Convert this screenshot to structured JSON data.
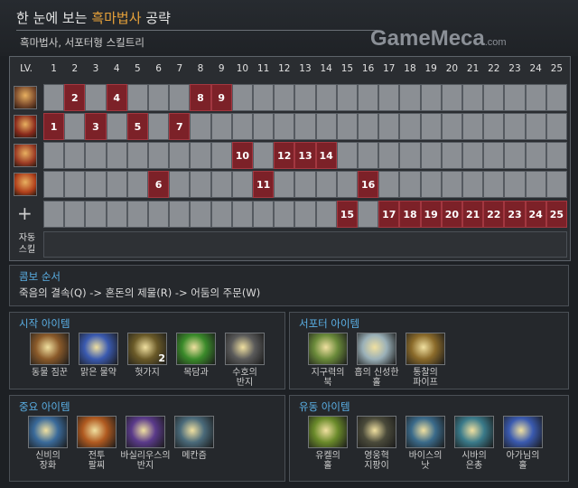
{
  "header": {
    "title_prefix": "한 눈에 보는 ",
    "title_highlight": "흑마법사",
    "title_suffix": " 공략",
    "subtitle": "흑마법사, 서포터형 스킬트리",
    "logo": "GameMeca",
    "logo_suffix": ".com"
  },
  "skill_table": {
    "level_label": "LV.",
    "levels": [
      "1",
      "2",
      "3",
      "4",
      "5",
      "6",
      "7",
      "8",
      "9",
      "10",
      "11",
      "12",
      "13",
      "14",
      "15",
      "16",
      "17",
      "18",
      "19",
      "20",
      "21",
      "22",
      "23",
      "24",
      "25"
    ],
    "rows": [
      {
        "icon": "skill-q-icon",
        "color": "#7a4a2c",
        "picks": [
          "",
          "2",
          "",
          "4",
          "",
          "",
          "",
          "8",
          "9",
          "",
          "",
          "",
          "",
          "",
          "",
          "",
          "",
          "",
          "",
          "",
          "",
          "",
          "",
          "",
          ""
        ]
      },
      {
        "icon": "skill-w-icon",
        "color": "#8a2a1c",
        "picks": [
          "1",
          "",
          "3",
          "",
          "5",
          "",
          "7",
          "",
          "",
          "",
          "",
          "",
          "",
          "",
          "",
          "",
          "",
          "",
          "",
          "",
          "",
          "",
          "",
          "",
          ""
        ]
      },
      {
        "icon": "skill-e-icon",
        "color": "#9a3a24",
        "picks": [
          "",
          "",
          "",
          "",
          "",
          "",
          "",
          "",
          "",
          "10",
          "",
          "12",
          "13",
          "14",
          "",
          "",
          "",
          "",
          "",
          "",
          "",
          "",
          "",
          "",
          ""
        ]
      },
      {
        "icon": "skill-r-icon",
        "color": "#b0401c",
        "picks": [
          "",
          "",
          "",
          "",
          "",
          "6",
          "",
          "",
          "",
          "",
          "11",
          "",
          "",
          "",
          "",
          "16",
          "",
          "",
          "",
          "",
          "",
          "",
          "",
          "",
          ""
        ]
      },
      {
        "icon": "plus-icon",
        "color": "",
        "picks": [
          "",
          "",
          "",
          "",
          "",
          "",
          "",
          "",
          "",
          "",
          "",
          "",
          "",
          "",
          "15",
          "",
          "17",
          "18",
          "19",
          "20",
          "21",
          "22",
          "23",
          "24",
          "25"
        ]
      }
    ],
    "plus_symbol": "+",
    "auto_skill_label_1": "자동",
    "auto_skill_label_2": "스킬"
  },
  "combo": {
    "title": "콤보 순서",
    "text": "죽음의 결속(Q) -> 혼돈의 제물(R) -> 어둠의 주문(W)"
  },
  "starting_items": {
    "title": "시작 아이템",
    "items": [
      {
        "icon": "courier-icon",
        "color": "#8a5a2a",
        "line1": "동물 짐꾼",
        "line2": "",
        "badge": ""
      },
      {
        "icon": "clarity-potion-icon",
        "color": "#3a5ab0",
        "line1": "맑은 물약",
        "line2": "",
        "badge": ""
      },
      {
        "icon": "branch-icon",
        "color": "#6a5a28",
        "line1": "헛가지",
        "line2": "",
        "badge": "2"
      },
      {
        "icon": "magic-stick-icon",
        "color": "#3a8a2a",
        "line1": "목담과",
        "line2": "",
        "badge": ""
      },
      {
        "icon": "ring-of-protection-icon",
        "color": "#5a5a5a",
        "line1": "수호의",
        "line2": "반지",
        "badge": ""
      }
    ]
  },
  "support_items": {
    "title": "서포터 아이템",
    "items": [
      {
        "icon": "tome-icon",
        "color": "#6a8a3a",
        "line1": "지구력의",
        "line2": "북",
        "badge": ""
      },
      {
        "icon": "wind-lace-icon",
        "color": "#9ab0b8",
        "line1": "흡의 신성한",
        "line2": "홀",
        "badge": ""
      },
      {
        "icon": "flute-icon",
        "color": "#8a6a2a",
        "line1": "통찰의",
        "line2": "파이프",
        "badge": ""
      }
    ]
  },
  "core_items": {
    "title": "중요 아이템",
    "items": [
      {
        "icon": "mystic-icon",
        "color": "#3a6a9a",
        "line1": "신비의",
        "line2": "장화",
        "badge": ""
      },
      {
        "icon": "war-drum-icon",
        "color": "#b05a20",
        "line1": "전투",
        "line2": "팔찌",
        "badge": ""
      },
      {
        "icon": "ring-icon",
        "color": "#5a3a8a",
        "line1": "바실리우스의",
        "line2": "반지",
        "badge": ""
      },
      {
        "icon": "mekansm-icon",
        "color": "#4a6a7a",
        "line1": "메칸즘",
        "line2": "",
        "badge": ""
      }
    ]
  },
  "flex_items": {
    "title": "유동 아이템",
    "items": [
      {
        "icon": "staff-icon",
        "color": "#6a8a2a",
        "line1": "유켈의",
        "line2": "홀",
        "badge": ""
      },
      {
        "icon": "spirit-staff-icon",
        "color": "#4a4a3a",
        "line1": "영웅혁",
        "line2": "지팡이",
        "badge": ""
      },
      {
        "icon": "scythe-icon",
        "color": "#3a6a8a",
        "line1": "바이스의",
        "line2": "낫",
        "badge": ""
      },
      {
        "icon": "shroud-icon",
        "color": "#3a7a8a",
        "line1": "시바의",
        "line2": "은총",
        "badge": ""
      },
      {
        "icon": "aghanim-scepter-icon",
        "color": "#3a5ab0",
        "line1": "아가님의",
        "line2": "홀",
        "badge": ""
      }
    ]
  }
}
